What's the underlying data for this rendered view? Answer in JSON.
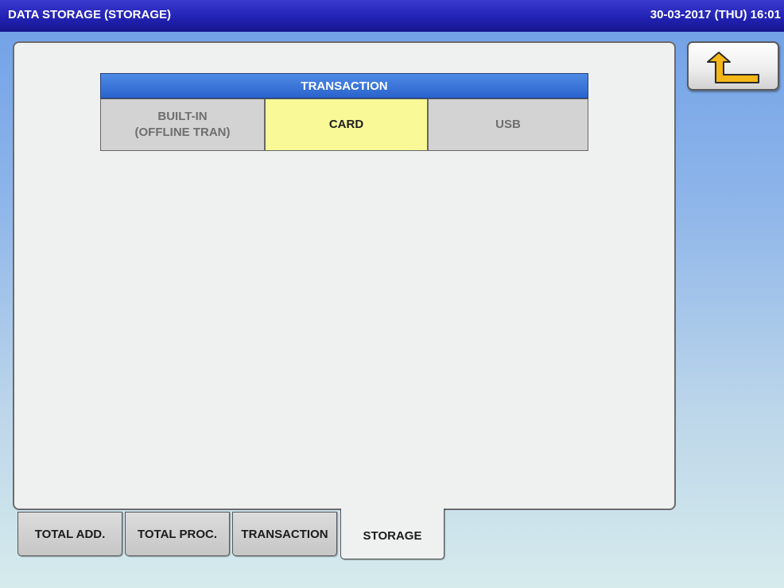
{
  "header": {
    "title": "DATA STORAGE (STORAGE)",
    "datetime": "30-03-2017 (THU)  16:01"
  },
  "back_button": {
    "icon": "return-arrow-icon",
    "color": "#f5b718"
  },
  "transaction_group": {
    "header": "TRANSACTION",
    "options": [
      {
        "label_line1": "BUILT-IN",
        "label_line2": "(OFFLINE TRAN)",
        "selected": false
      },
      {
        "label": "CARD",
        "selected": true
      },
      {
        "label": "USB",
        "selected": false
      }
    ]
  },
  "tabs": [
    {
      "label": "TOTAL ADD.",
      "active": false
    },
    {
      "label": "TOTAL PROC.",
      "active": false
    },
    {
      "label": "TRANSACTION",
      "active": false
    },
    {
      "label": "STORAGE",
      "active": true
    }
  ],
  "colors": {
    "titlebar": "#2222b4",
    "selected_option": "#f9f998",
    "group_header": "#2a63cc"
  }
}
